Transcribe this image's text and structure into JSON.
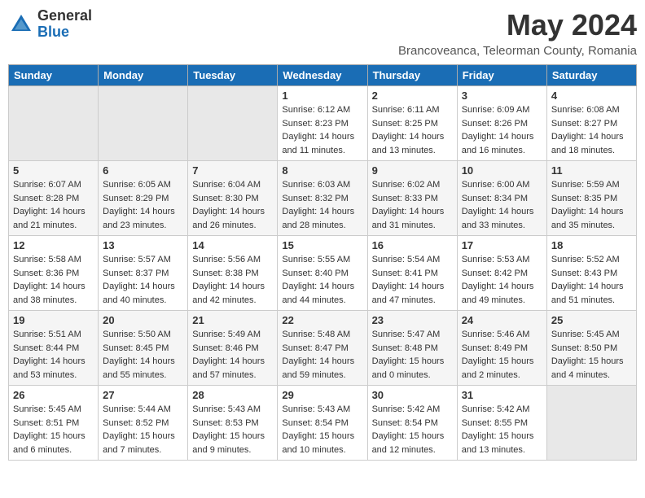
{
  "header": {
    "logo_general": "General",
    "logo_blue": "Blue",
    "month_year": "May 2024",
    "location": "Brancoveanca, Teleorman County, Romania"
  },
  "weekdays": [
    "Sunday",
    "Monday",
    "Tuesday",
    "Wednesday",
    "Thursday",
    "Friday",
    "Saturday"
  ],
  "weeks": [
    [
      {
        "day": "",
        "sunrise": "",
        "sunset": "",
        "daylight": ""
      },
      {
        "day": "",
        "sunrise": "",
        "sunset": "",
        "daylight": ""
      },
      {
        "day": "",
        "sunrise": "",
        "sunset": "",
        "daylight": ""
      },
      {
        "day": "1",
        "sunrise": "Sunrise: 6:12 AM",
        "sunset": "Sunset: 8:23 PM",
        "daylight": "Daylight: 14 hours and 11 minutes."
      },
      {
        "day": "2",
        "sunrise": "Sunrise: 6:11 AM",
        "sunset": "Sunset: 8:25 PM",
        "daylight": "Daylight: 14 hours and 13 minutes."
      },
      {
        "day": "3",
        "sunrise": "Sunrise: 6:09 AM",
        "sunset": "Sunset: 8:26 PM",
        "daylight": "Daylight: 14 hours and 16 minutes."
      },
      {
        "day": "4",
        "sunrise": "Sunrise: 6:08 AM",
        "sunset": "Sunset: 8:27 PM",
        "daylight": "Daylight: 14 hours and 18 minutes."
      }
    ],
    [
      {
        "day": "5",
        "sunrise": "Sunrise: 6:07 AM",
        "sunset": "Sunset: 8:28 PM",
        "daylight": "Daylight: 14 hours and 21 minutes."
      },
      {
        "day": "6",
        "sunrise": "Sunrise: 6:05 AM",
        "sunset": "Sunset: 8:29 PM",
        "daylight": "Daylight: 14 hours and 23 minutes."
      },
      {
        "day": "7",
        "sunrise": "Sunrise: 6:04 AM",
        "sunset": "Sunset: 8:30 PM",
        "daylight": "Daylight: 14 hours and 26 minutes."
      },
      {
        "day": "8",
        "sunrise": "Sunrise: 6:03 AM",
        "sunset": "Sunset: 8:32 PM",
        "daylight": "Daylight: 14 hours and 28 minutes."
      },
      {
        "day": "9",
        "sunrise": "Sunrise: 6:02 AM",
        "sunset": "Sunset: 8:33 PM",
        "daylight": "Daylight: 14 hours and 31 minutes."
      },
      {
        "day": "10",
        "sunrise": "Sunrise: 6:00 AM",
        "sunset": "Sunset: 8:34 PM",
        "daylight": "Daylight: 14 hours and 33 minutes."
      },
      {
        "day": "11",
        "sunrise": "Sunrise: 5:59 AM",
        "sunset": "Sunset: 8:35 PM",
        "daylight": "Daylight: 14 hours and 35 minutes."
      }
    ],
    [
      {
        "day": "12",
        "sunrise": "Sunrise: 5:58 AM",
        "sunset": "Sunset: 8:36 PM",
        "daylight": "Daylight: 14 hours and 38 minutes."
      },
      {
        "day": "13",
        "sunrise": "Sunrise: 5:57 AM",
        "sunset": "Sunset: 8:37 PM",
        "daylight": "Daylight: 14 hours and 40 minutes."
      },
      {
        "day": "14",
        "sunrise": "Sunrise: 5:56 AM",
        "sunset": "Sunset: 8:38 PM",
        "daylight": "Daylight: 14 hours and 42 minutes."
      },
      {
        "day": "15",
        "sunrise": "Sunrise: 5:55 AM",
        "sunset": "Sunset: 8:40 PM",
        "daylight": "Daylight: 14 hours and 44 minutes."
      },
      {
        "day": "16",
        "sunrise": "Sunrise: 5:54 AM",
        "sunset": "Sunset: 8:41 PM",
        "daylight": "Daylight: 14 hours and 47 minutes."
      },
      {
        "day": "17",
        "sunrise": "Sunrise: 5:53 AM",
        "sunset": "Sunset: 8:42 PM",
        "daylight": "Daylight: 14 hours and 49 minutes."
      },
      {
        "day": "18",
        "sunrise": "Sunrise: 5:52 AM",
        "sunset": "Sunset: 8:43 PM",
        "daylight": "Daylight: 14 hours and 51 minutes."
      }
    ],
    [
      {
        "day": "19",
        "sunrise": "Sunrise: 5:51 AM",
        "sunset": "Sunset: 8:44 PM",
        "daylight": "Daylight: 14 hours and 53 minutes."
      },
      {
        "day": "20",
        "sunrise": "Sunrise: 5:50 AM",
        "sunset": "Sunset: 8:45 PM",
        "daylight": "Daylight: 14 hours and 55 minutes."
      },
      {
        "day": "21",
        "sunrise": "Sunrise: 5:49 AM",
        "sunset": "Sunset: 8:46 PM",
        "daylight": "Daylight: 14 hours and 57 minutes."
      },
      {
        "day": "22",
        "sunrise": "Sunrise: 5:48 AM",
        "sunset": "Sunset: 8:47 PM",
        "daylight": "Daylight: 14 hours and 59 minutes."
      },
      {
        "day": "23",
        "sunrise": "Sunrise: 5:47 AM",
        "sunset": "Sunset: 8:48 PM",
        "daylight": "Daylight: 15 hours and 0 minutes."
      },
      {
        "day": "24",
        "sunrise": "Sunrise: 5:46 AM",
        "sunset": "Sunset: 8:49 PM",
        "daylight": "Daylight: 15 hours and 2 minutes."
      },
      {
        "day": "25",
        "sunrise": "Sunrise: 5:45 AM",
        "sunset": "Sunset: 8:50 PM",
        "daylight": "Daylight: 15 hours and 4 minutes."
      }
    ],
    [
      {
        "day": "26",
        "sunrise": "Sunrise: 5:45 AM",
        "sunset": "Sunset: 8:51 PM",
        "daylight": "Daylight: 15 hours and 6 minutes."
      },
      {
        "day": "27",
        "sunrise": "Sunrise: 5:44 AM",
        "sunset": "Sunset: 8:52 PM",
        "daylight": "Daylight: 15 hours and 7 minutes."
      },
      {
        "day": "28",
        "sunrise": "Sunrise: 5:43 AM",
        "sunset": "Sunset: 8:53 PM",
        "daylight": "Daylight: 15 hours and 9 minutes."
      },
      {
        "day": "29",
        "sunrise": "Sunrise: 5:43 AM",
        "sunset": "Sunset: 8:54 PM",
        "daylight": "Daylight: 15 hours and 10 minutes."
      },
      {
        "day": "30",
        "sunrise": "Sunrise: 5:42 AM",
        "sunset": "Sunset: 8:54 PM",
        "daylight": "Daylight: 15 hours and 12 minutes."
      },
      {
        "day": "31",
        "sunrise": "Sunrise: 5:42 AM",
        "sunset": "Sunset: 8:55 PM",
        "daylight": "Daylight: 15 hours and 13 minutes."
      },
      {
        "day": "",
        "sunrise": "",
        "sunset": "",
        "daylight": ""
      }
    ]
  ]
}
